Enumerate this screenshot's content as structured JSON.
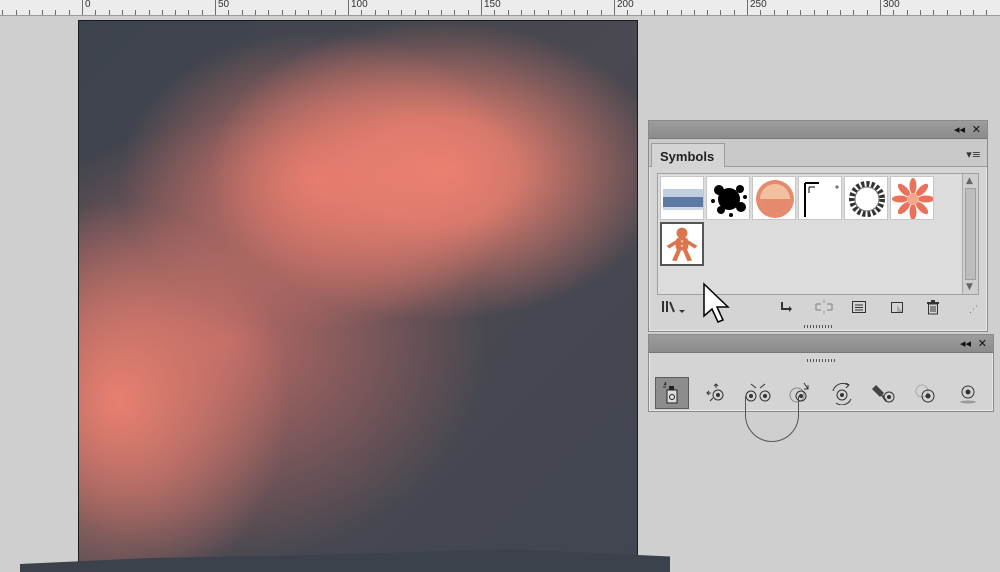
{
  "ruler": {
    "labels": [
      "0",
      "50",
      "100",
      "150",
      "200",
      "250",
      "300"
    ]
  },
  "symbols_panel": {
    "tab_label": "Symbols",
    "collapse_glyph": "◂◂",
    "close_glyph": "✕",
    "menu_glyph": "▾≡",
    "thumbnails": [
      {
        "name": "water-symbol-icon",
        "colors": [
          "#5d7aa3",
          "#bfcfdf"
        ]
      },
      {
        "name": "ink-splat-symbol-icon",
        "colors": [
          "#000000"
        ]
      },
      {
        "name": "orange-button-symbol-icon",
        "colors": [
          "#e58a6c",
          "#f3c09f"
        ]
      },
      {
        "name": "corner-crop-symbol-icon",
        "colors": [
          "#000000"
        ]
      },
      {
        "name": "ring-pattern-symbol-icon",
        "colors": [
          "#333333"
        ]
      },
      {
        "name": "flower-symbol-icon",
        "colors": [
          "#e8725a",
          "#f4a88f"
        ]
      },
      {
        "name": "gingerbread-symbol-icon",
        "colors": [
          "#d9764e",
          "#f2c3a3"
        ]
      }
    ],
    "bottom_icons": [
      "symbol-libraries-icon",
      "place-symbol-icon",
      "break-link-icon",
      "symbol-options-icon",
      "new-symbol-icon",
      "delete-symbol-icon"
    ]
  },
  "tools_panel": {
    "collapse_glyph": "◂◂",
    "close_glyph": "✕",
    "tools": [
      "symbol-sprayer-icon",
      "symbol-shifter-icon",
      "symbol-scruncher-icon",
      "symbol-sizer-icon",
      "symbol-spinner-icon",
      "symbol-stainer-icon",
      "symbol-screener-icon",
      "symbol-styler-icon"
    ]
  },
  "colors": {
    "accent_salmon": "#e8806f",
    "canvas_dark": "#3f454e"
  }
}
